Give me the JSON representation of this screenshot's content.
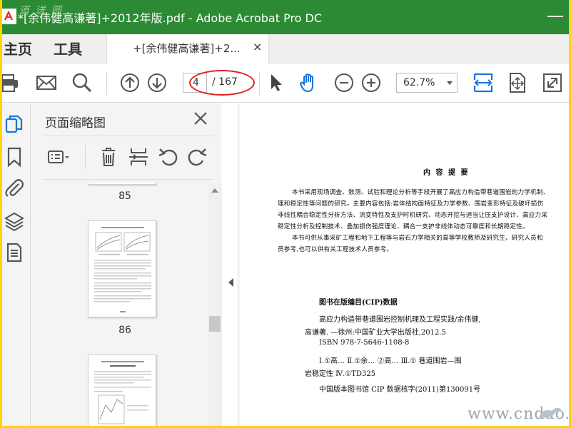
{
  "window": {
    "title": "*[余伟健高谦著]+2012年版.pdf - Adobe Acrobat Pro DC",
    "title_watermark": "道 送 圆"
  },
  "nav": {
    "home_label": "主页",
    "tools_label": "工具",
    "doc_tab_label": "+[余伟健高谦著]+2...",
    "doc_tab_close": "×"
  },
  "toolbar": {
    "current_page": "4",
    "page_total": "/ 167",
    "zoom": "62.7%"
  },
  "sidebar": {
    "panel_title": "页面缩略图",
    "thumbnails": [
      {
        "label": "85"
      },
      {
        "label": "86"
      }
    ]
  },
  "document": {
    "heading": "内 容 提 要",
    "summary_lines": [
      "本书采用现场调查、数测、试验和理论分析等手段开展了高应力构造带巷道围岩的力学机制、",
      "理和稳定性等问题的研究。主要内容包括:岩体结构面特征及力学参数、围岩变形特征及破坏损伤",
      "非线性耦合稳定性分析方法、流变特性及支护时机研究、动态开挖与适当让压支护设计、高应力采",
      "稳定性分析及控制技术、叠加损伤强度理论、耦合一支护非线体动态可靠度和长期稳定性。",
      "本书可供从事采矿工程和地下工程等与岩石力学相关的高等学校教师及研究生、研究人员和",
      "员参考,也可以供有关工程技术人员参考。"
    ],
    "cip_heading": "图书在版编目(CIP)数据",
    "cip_lines": [
      "高应力构造带巷道围岩控制机理及工程实践/余伟健,",
      "高谦著. —徐州:中国矿业大学出版社,2012.5",
      "ISBN 978-7-5646-1108-8",
      "Ⅰ.①高… Ⅱ.①余… ②高… Ⅲ.① 巷道围岩—围",
      "岩稳定性 Ⅳ.①TD325",
      "中国版本图书馆 CIP 数据核字(2011)第130091号"
    ]
  },
  "watermark_site": "www.cndao.com",
  "colors": {
    "titlebar": "#2d8a34",
    "frame": "#ffd400",
    "accent_blue": "#1a73d9",
    "annotation_red": "#e0201b"
  }
}
